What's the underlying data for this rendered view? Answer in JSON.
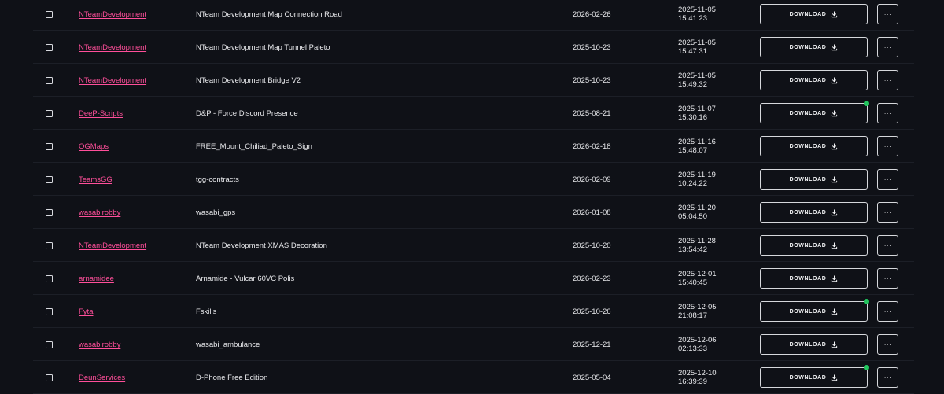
{
  "table": {
    "download_label": "DOWNLOAD",
    "more_label": "···",
    "rows": [
      {
        "author": "NTeamDevelopment",
        "name": "NTeam Development Map Connection Road",
        "date": "2026-02-26",
        "updated_date": "2025-11-05",
        "updated_time": "15:41:23",
        "online": false
      },
      {
        "author": "NTeamDevelopment",
        "name": "NTeam Development Map Tunnel Paleto",
        "date": "2025-10-23",
        "updated_date": "2025-11-05",
        "updated_time": "15:47:31",
        "online": false
      },
      {
        "author": "NTeamDevelopment",
        "name": "NTeam Development Bridge V2",
        "date": "2025-10-23",
        "updated_date": "2025-11-05",
        "updated_time": "15:49:32",
        "online": false
      },
      {
        "author": "DeeP-Scripts",
        "name": "D&P - Force Discord Presence",
        "date": "2025-08-21",
        "updated_date": "2025-11-07",
        "updated_time": "15:30:16",
        "online": true
      },
      {
        "author": "OGMaps",
        "name": "FREE_Mount_Chiliad_Paleto_Sign",
        "date": "2026-02-18",
        "updated_date": "2025-11-16",
        "updated_time": "15:48:07",
        "online": false
      },
      {
        "author": "TeamsGG",
        "name": "tgg-contracts",
        "date": "2026-02-09",
        "updated_date": "2025-11-19",
        "updated_time": "10:24:22",
        "online": false
      },
      {
        "author": "wasabirobby",
        "name": "wasabi_gps",
        "date": "2026-01-08",
        "updated_date": "2025-11-20",
        "updated_time": "05:04:50",
        "online": false
      },
      {
        "author": "NTeamDevelopment",
        "name": "NTeam Development XMAS Decoration",
        "date": "2025-10-20",
        "updated_date": "2025-11-28",
        "updated_time": "13:54:42",
        "online": false
      },
      {
        "author": "arnamidee",
        "name": "Arnamide - Vulcar 60VC Polis",
        "date": "2026-02-23",
        "updated_date": "2025-12-01",
        "updated_time": "15:40:45",
        "online": false
      },
      {
        "author": "Fyta",
        "name": "Fskills",
        "date": "2025-10-26",
        "updated_date": "2025-12-05",
        "updated_time": "21:08:17",
        "online": true
      },
      {
        "author": "wasabirobby",
        "name": "wasabi_ambulance",
        "date": "2025-12-21",
        "updated_date": "2025-12-06",
        "updated_time": "02:13:33",
        "online": false
      },
      {
        "author": "DeunServices",
        "name": "D-Phone Free Edition",
        "date": "2025-05-04",
        "updated_date": "2025-12-10",
        "updated_time": "16:39:39",
        "online": true
      }
    ]
  },
  "colors": {
    "background": "#0f1117",
    "author_link": "#ff4f9a",
    "status_dot": "#22c55e",
    "row_divider": "#1c1f27"
  },
  "icons": {
    "download": "download-icon",
    "more": "more-options-icon",
    "checkbox": "checkbox-icon",
    "status": "status-dot-icon"
  }
}
